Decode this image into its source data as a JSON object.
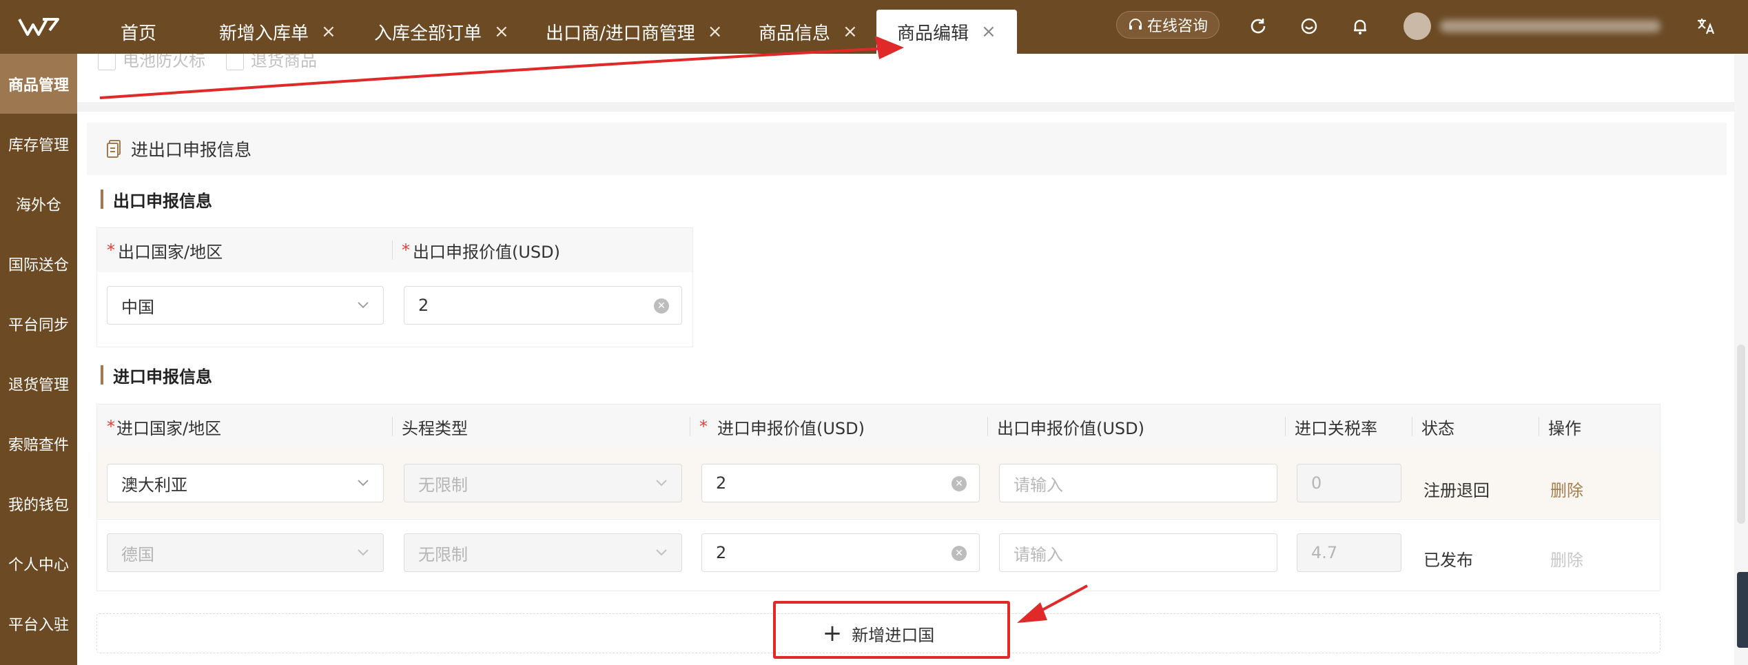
{
  "topbar": {
    "tabs": [
      {
        "label": "首页",
        "closable": false
      },
      {
        "label": "新增入库单",
        "closable": true
      },
      {
        "label": "入库全部订单",
        "closable": true
      },
      {
        "label": "出口商/进口商管理",
        "closable": true
      },
      {
        "label": "商品信息",
        "closable": true
      },
      {
        "label": "商品编辑",
        "closable": true,
        "active": true
      }
    ],
    "close_glyph": "×",
    "consult_label": "在线咨询",
    "icons": [
      "refresh-icon",
      "service-icon",
      "bell-icon",
      "translate-icon"
    ]
  },
  "sidebar": {
    "items": [
      {
        "label": "商品管理",
        "active": true
      },
      {
        "label": "库存管理"
      },
      {
        "label": "海外仓"
      },
      {
        "label": "国际送仓"
      },
      {
        "label": "平台同步"
      },
      {
        "label": "退货管理"
      },
      {
        "label": "索赔查件"
      },
      {
        "label": "我的钱包"
      },
      {
        "label": "个人中心"
      },
      {
        "label": "平台入驻"
      }
    ]
  },
  "main": {
    "checkbox_row": [
      "电池防火标",
      "退货商品"
    ],
    "section_title": "进出口申报信息",
    "export": {
      "title": "出口申报信息",
      "headers": [
        "出口国家/地区",
        "出口申报价值(USD)"
      ],
      "required_mark": "*",
      "row": {
        "country": "中国",
        "value": "2"
      }
    },
    "import": {
      "title": "进口申报信息",
      "headers": [
        "进口国家/地区",
        "头程类型",
        "进口申报价值(USD)",
        "出口申报价值(USD)",
        "进口关税率",
        "状态",
        "操作"
      ],
      "rows": [
        {
          "country": "澳大利亚",
          "first_leg": "无限制",
          "import_value": "2",
          "export_value_placeholder": "请输入",
          "tax_rate": "0",
          "status": "注册退回",
          "action": "删除"
        },
        {
          "country": "德国",
          "first_leg": "无限制",
          "import_value": "2",
          "export_value_placeholder": "请输入",
          "tax_rate": "4.7",
          "status": "已发布",
          "action": "删除"
        }
      ]
    },
    "add_button_label": "新增进口国",
    "add_button_icon": "+"
  },
  "colors": {
    "brand_brown": "#6b4a24",
    "active_side": "#9c7750",
    "accent_link": "#a57d4e",
    "required_red": "#e0403a",
    "annotation_red": "#e02a2a"
  }
}
